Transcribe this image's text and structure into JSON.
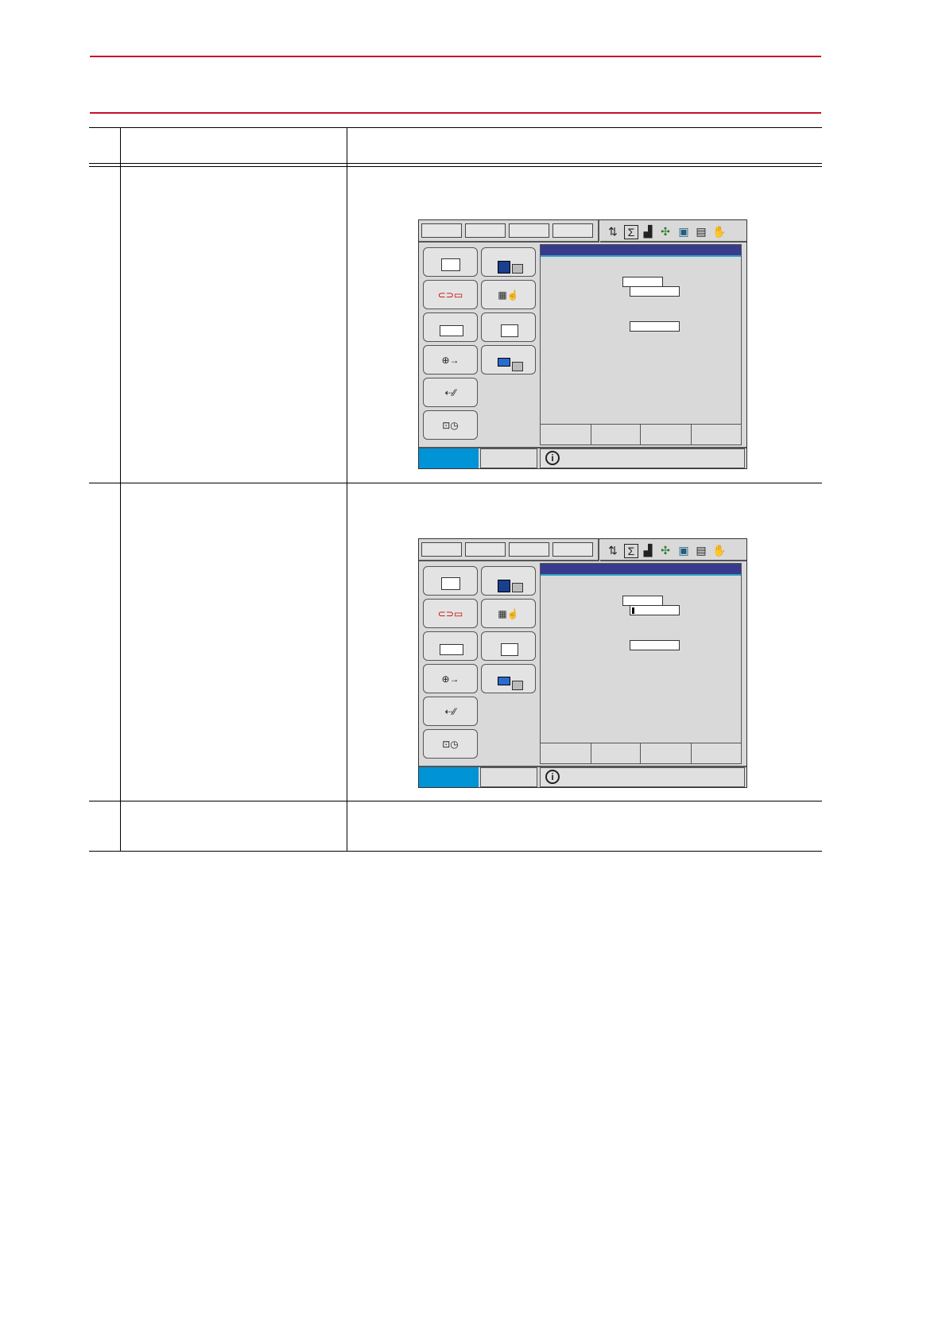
{
  "document": {
    "colors": {
      "rule": "#c8102e",
      "mode_active": "#0093d6",
      "title_bar": "#3a3a8c"
    }
  },
  "screens": [
    {
      "status_icons": [
        "axis-icon",
        "sigma-icon",
        "signal-icon",
        "robot-icon",
        "monitor-icon",
        "note-icon",
        "hand-icon"
      ],
      "menu_icons": [
        "job-icon",
        "file-icon",
        "arc-welding-icon",
        "variable-icon",
        "io-icon",
        "robot-icon",
        "setup-icon",
        "display-setup-icon",
        "system-icon",
        "monitor-icon"
      ],
      "input_cursor": false
    },
    {
      "status_icons": [
        "axis-icon",
        "sigma-icon",
        "signal-icon",
        "robot-icon",
        "monitor-icon",
        "note-icon",
        "hand-icon"
      ],
      "menu_icons": [
        "job-icon",
        "file-icon",
        "arc-welding-icon",
        "variable-icon",
        "io-icon",
        "robot-icon",
        "setup-icon",
        "display-setup-icon",
        "system-icon",
        "monitor-icon"
      ],
      "input_cursor": true
    }
  ]
}
